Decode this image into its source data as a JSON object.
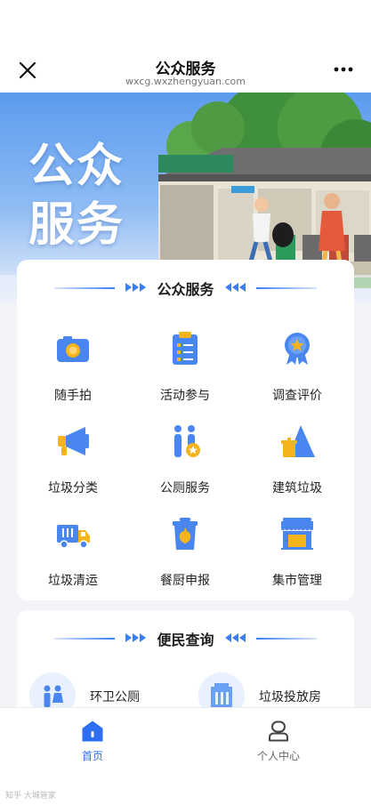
{
  "header": {
    "title": "公众服务",
    "url": "wxcg.wxzhengyuan.com"
  },
  "banner": {
    "title_line1": "公众",
    "title_line2": "服务"
  },
  "public_services": {
    "title": "公众服务",
    "items": [
      {
        "label": "随手拍",
        "icon": "camera-icon"
      },
      {
        "label": "活动参与",
        "icon": "clipboard-icon"
      },
      {
        "label": "调查评价",
        "icon": "medal-icon"
      },
      {
        "label": "垃圾分类",
        "icon": "megaphone-icon"
      },
      {
        "label": "公厕服务",
        "icon": "restroom-icon"
      },
      {
        "label": "建筑垃圾",
        "icon": "construction-waste-icon"
      },
      {
        "label": "垃圾清运",
        "icon": "garbage-truck-icon"
      },
      {
        "label": "餐厨申报",
        "icon": "kitchen-bin-icon"
      },
      {
        "label": "集市管理",
        "icon": "market-stall-icon"
      }
    ]
  },
  "convenience_query": {
    "title": "便民查询",
    "items": [
      {
        "label": "环卫公厕",
        "icon": "restroom-icon"
      },
      {
        "label": "垃圾投放房",
        "icon": "trash-house-icon"
      }
    ]
  },
  "tabbar": {
    "home_label": "首页",
    "me_label": "个人中心"
  },
  "colors": {
    "accent": "#3a7ff5",
    "icon_blue": "#4a86f0",
    "icon_gold": "#f5b31c"
  },
  "watermark": "知乎 大城管家"
}
